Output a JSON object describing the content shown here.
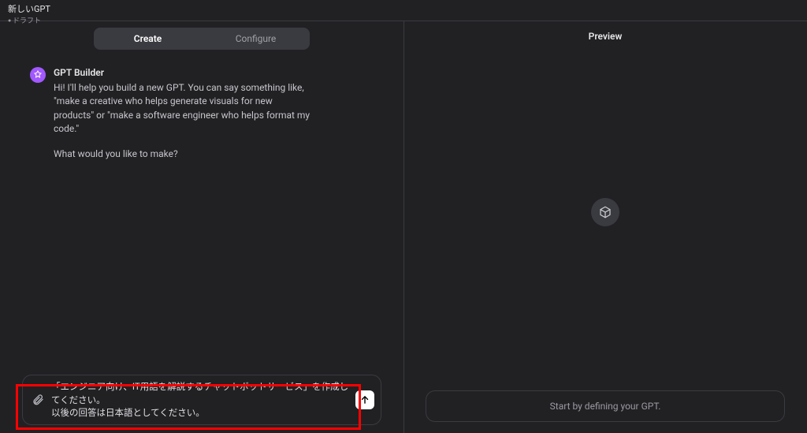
{
  "header": {
    "title": "新しいGPT",
    "subtitle": "ドラフト"
  },
  "tabs": {
    "create": "Create",
    "configure": "Configure"
  },
  "builder": {
    "name": "GPT Builder",
    "intro": "Hi! I'll help you build a new GPT. You can say something like, \"make a creative who helps generate visuals for new products\" or \"make a software engineer who helps format my code.\"",
    "prompt": "What would you like to make?"
  },
  "input": {
    "value": "「エンジニア向け、IT用語を解説するチャットボットサービス」を作成してください。\n以後の回答は日本語としてください。"
  },
  "preview": {
    "title": "Preview",
    "placeholder": "Start by defining your GPT."
  }
}
